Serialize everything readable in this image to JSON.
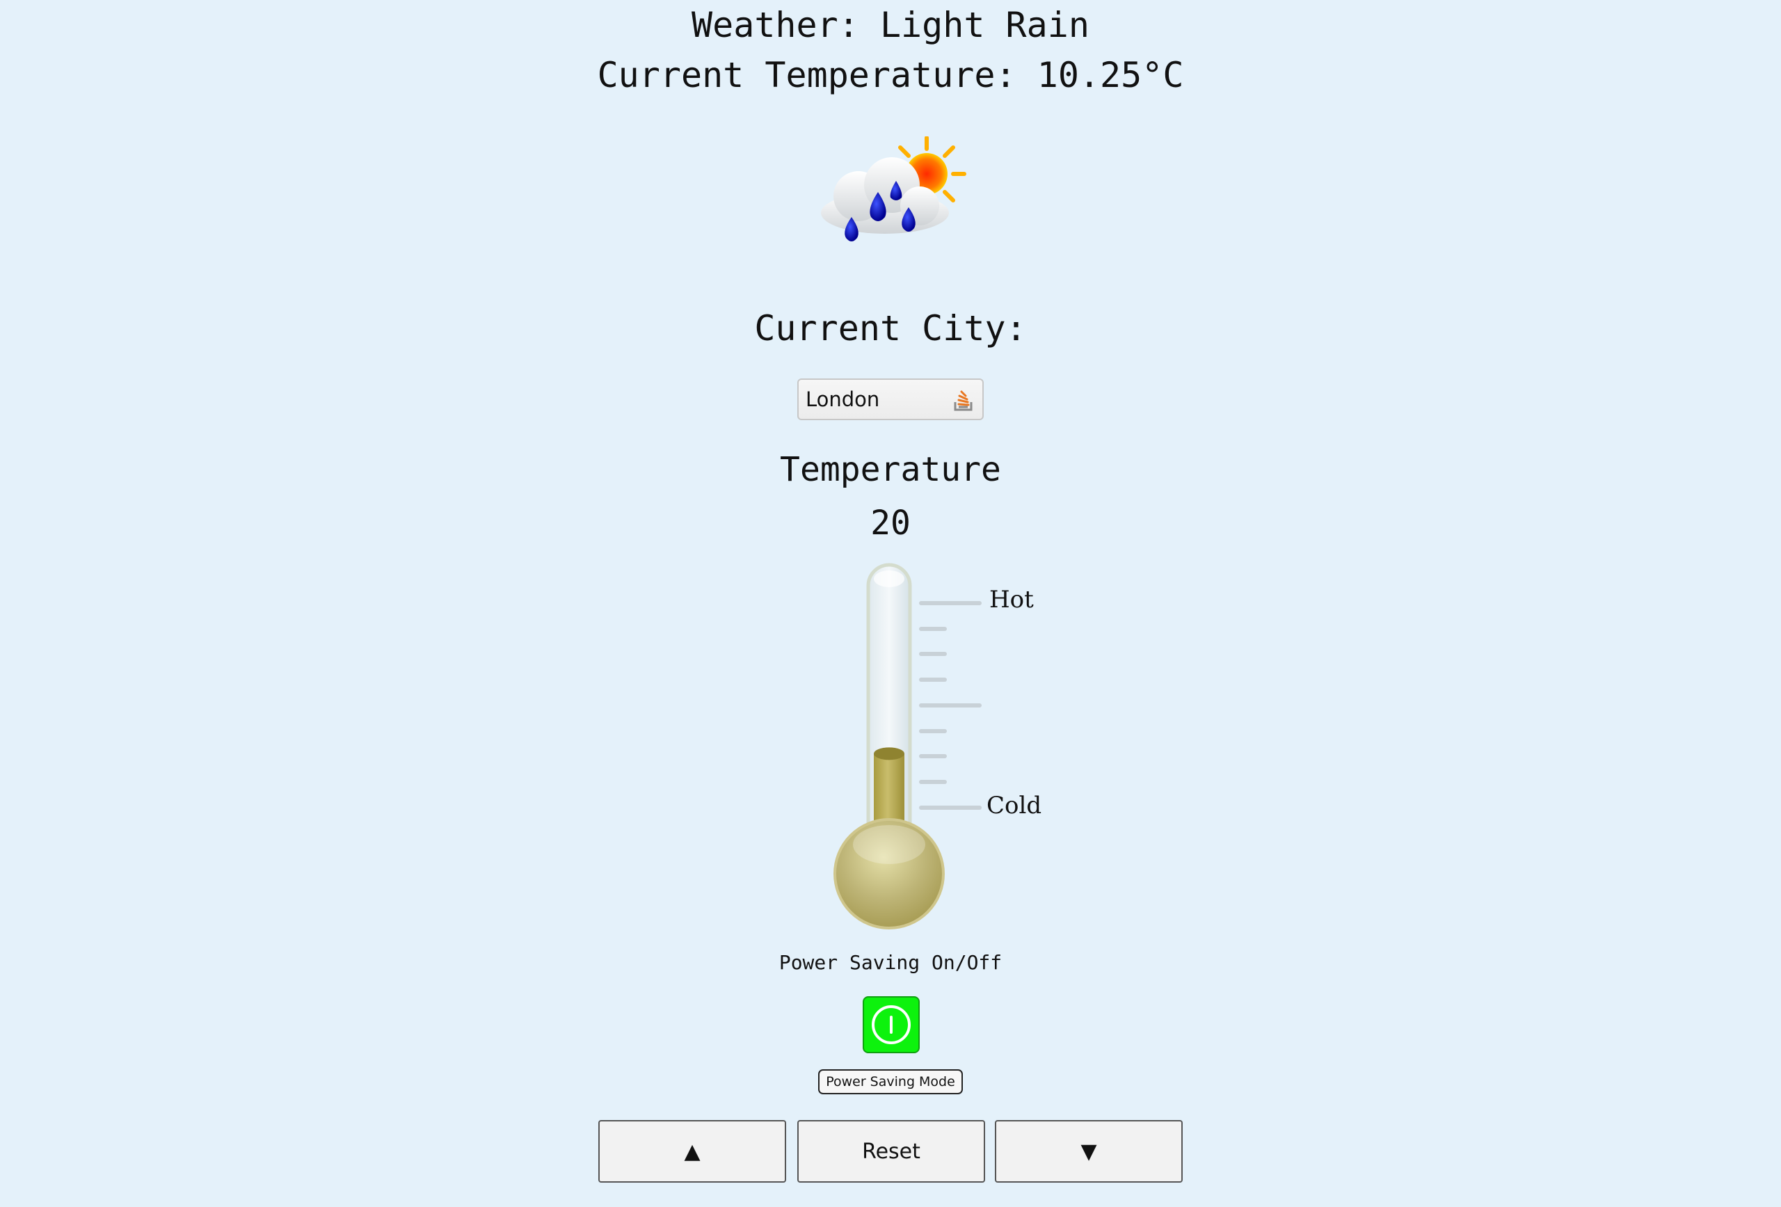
{
  "header": {
    "weather": "Weather: Light Rain",
    "current_temperature": "Current Temperature: 10.25°C"
  },
  "weather_icon": "cloud-rain-sun-icon",
  "city": {
    "heading": "Current City:",
    "selected": "London"
  },
  "thermostat": {
    "heading": "Temperature",
    "value": "20",
    "label_hot": "Hot",
    "label_cold": "Cold",
    "fill_fraction": 0.42,
    "fill_color": "#b4a84e"
  },
  "power_saving": {
    "label": "Power Saving On/Off",
    "toggle_state": "on",
    "toggle_color": "#0df20d",
    "mode_button": "Power Saving Mode"
  },
  "controls": {
    "up": "▲",
    "reset": "Reset",
    "down": "▼"
  }
}
